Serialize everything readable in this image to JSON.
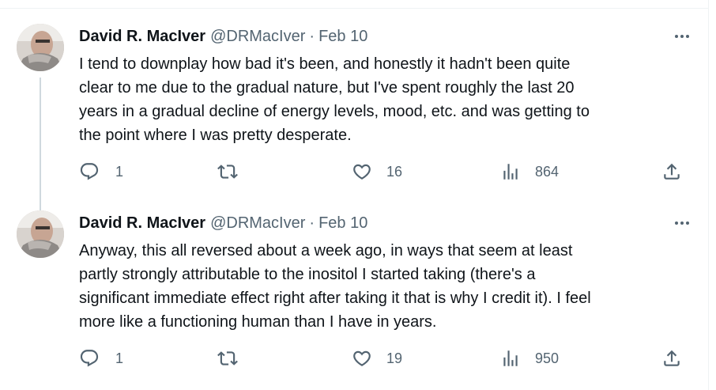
{
  "tweets": [
    {
      "author_name": "David R. MacIver",
      "handle": "@DRMacIver",
      "separator": "·",
      "date": "Feb 10",
      "text": "I tend to downplay how bad it's been, and honestly it hadn't been quite\nclear to me due to the gradual nature, but I've spent roughly the last 20\nyears in a gradual decline of energy levels, mood, etc. and was getting to\nthe point where I was pretty desperate.",
      "replies": "1",
      "likes": "16",
      "views": "864"
    },
    {
      "author_name": "David R. MacIver",
      "handle": "@DRMacIver",
      "separator": "·",
      "date": "Feb 10",
      "text": "Anyway, this all reversed about a week ago, in ways that seem at least\npartly strongly attributable to the inositol I started taking (there's a\nsignificant immediate effect right after taking it that is why I credit it). I feel\nmore like a functioning human than I have in years.",
      "replies": "1",
      "likes": "19",
      "views": "950"
    }
  ],
  "icons": {
    "more": "more-dots-icon",
    "reply": "reply-bubble-icon",
    "retweet": "retweet-icon",
    "like": "heart-icon",
    "views": "bar-chart-icon",
    "share": "share-upload-icon"
  },
  "colors": {
    "text": "#0f1419",
    "muted": "#536471",
    "divider": "#eff3f4",
    "thread_line": "#cfd9de"
  }
}
